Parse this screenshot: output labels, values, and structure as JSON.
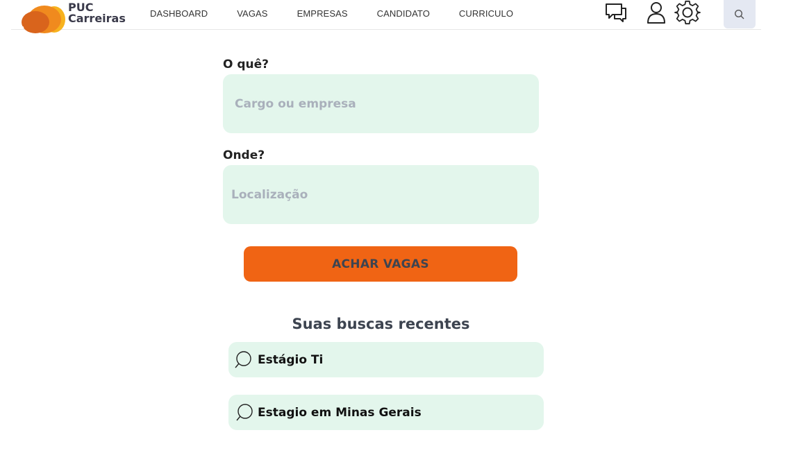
{
  "brand": {
    "line1": "PUC",
    "line2": "Carreiras",
    "colors": {
      "dark_orange": "#d9641c",
      "mid_orange": "#f08a1e",
      "light_orange": "#f7b21e"
    }
  },
  "nav": {
    "links": [
      {
        "label": "DASHBOARD"
      },
      {
        "label": "VAGAS"
      },
      {
        "label": "EMPRESAS"
      },
      {
        "label": "CANDIDATO"
      },
      {
        "label": "CURRICULO"
      }
    ],
    "icons": [
      "chat-icon",
      "user-icon",
      "gear-icon",
      "search-icon"
    ]
  },
  "search": {
    "what_label": "O quê?",
    "what_placeholder": "Cargo ou empresa",
    "where_label": "Onde?",
    "where_placeholder": "Localização",
    "submit_label": "ACHAR VAGAS"
  },
  "recent": {
    "title": "Suas buscas recentes",
    "items": [
      {
        "label": "Estágio Ti"
      },
      {
        "label": "Estagio em Minas Gerais"
      }
    ]
  },
  "colors": {
    "accent": "#f06414",
    "input_bg": "#e3f6ec",
    "search_btn_bg": "#e4e8f2"
  }
}
